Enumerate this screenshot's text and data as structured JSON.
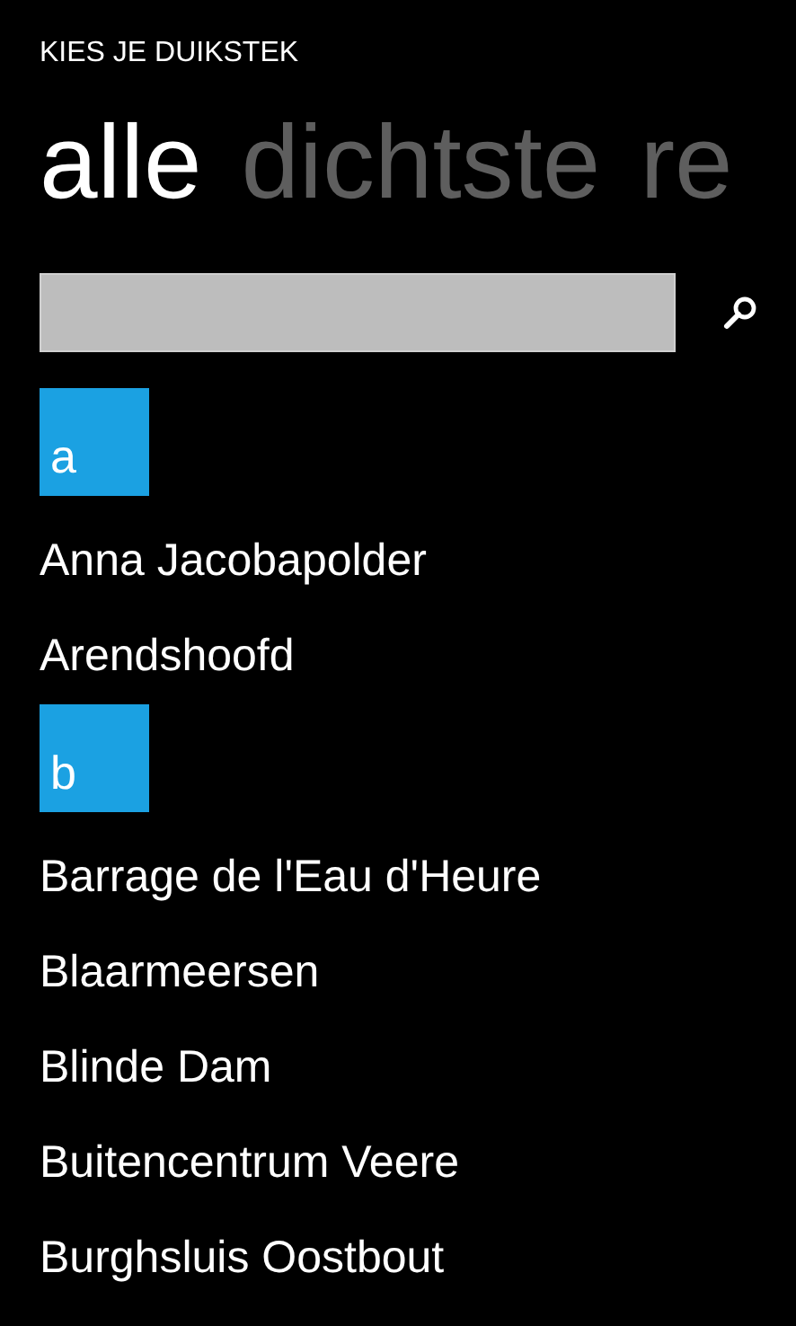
{
  "app_title": "KIES JE DUIKSTEK",
  "pivots": [
    {
      "label": "alle",
      "selected": true
    },
    {
      "label": "dichtste",
      "selected": false
    },
    {
      "label": "re",
      "selected": false
    }
  ],
  "groups": [
    {
      "letter": "a",
      "items": [
        "Anna Jacobapolder",
        "Arendshoofd"
      ]
    },
    {
      "letter": "b",
      "items": [
        "Barrage de l'Eau d'Heure",
        "Blaarmeersen",
        "Blinde Dam",
        "Buitencentrum Veere",
        "Burghsluis Oostbout"
      ]
    }
  ]
}
